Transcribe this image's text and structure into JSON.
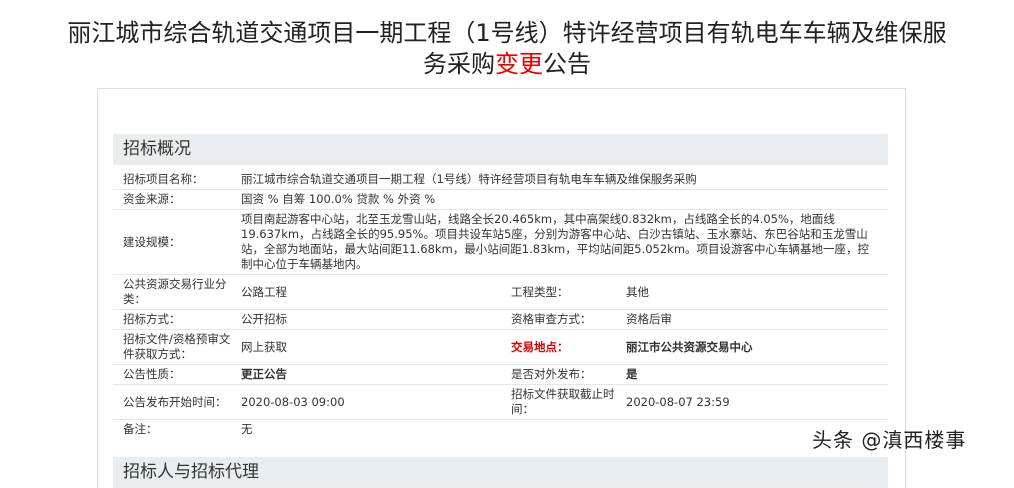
{
  "title": {
    "line1": "丽江城市综合轨道交通项目一期工程（1号线）特许经营项目有轨电车车辆及维保服",
    "line2_a": "务采购",
    "line2_red": "变更",
    "line2_b": "公告"
  },
  "section1": {
    "heading": "招标概况",
    "project_name_label": "招标项目名称：",
    "project_name": "丽江城市综合轨道交通项目一期工程（1号线）特许经营项目有轨电车车辆及维保服务采购",
    "fund_label": "资金来源：",
    "fund": "国资 % 自筹 100.0% 贷款 % 外资 %",
    "scale_label": "建设规模：",
    "scale": "项目南起游客中心站，北至玉龙雪山站，线路全长20.465km，其中高架线0.832km，占线路全长的4.05%，地面线19.637km，占线路全长的95.95%。项目共设车站5座，分别为游客中心站、白沙古镇站、玉水寨站、东巴谷站和玉龙雪山站，全部为地面站，最大站间距11.68km，最小站间距1.83km，平均站间距5.052km。项目设游客中心车辆基地一座，控制中心位于车辆基地内。",
    "industry_label": "公共资源交易行业分类：",
    "industry": "公路工程",
    "type_label": "工程类型：",
    "type": "其他",
    "method_label": "招标方式：",
    "method": "公开招标",
    "review_label": "资格审查方式：",
    "review": "资格后审",
    "doc_label": "招标文件/资格预审文件获取方式：",
    "doc": "网上获取",
    "place_label": "交易地点：",
    "place": "丽江市公共资源交易中心",
    "nature_label": "公告性质：",
    "nature": "更正公告",
    "public_label": "是否对外发布：",
    "public": "是",
    "start_label": "公告发布开始时间：",
    "start": "2020-08-03 09:00",
    "deadline_label": "招标文件获取截止时间：",
    "deadline": "2020-08-07 23:59",
    "note_label": "备注：",
    "note": "无"
  },
  "section2": {
    "heading": "招标人与招标代理"
  },
  "watermark": "头条 @滇西楼事"
}
